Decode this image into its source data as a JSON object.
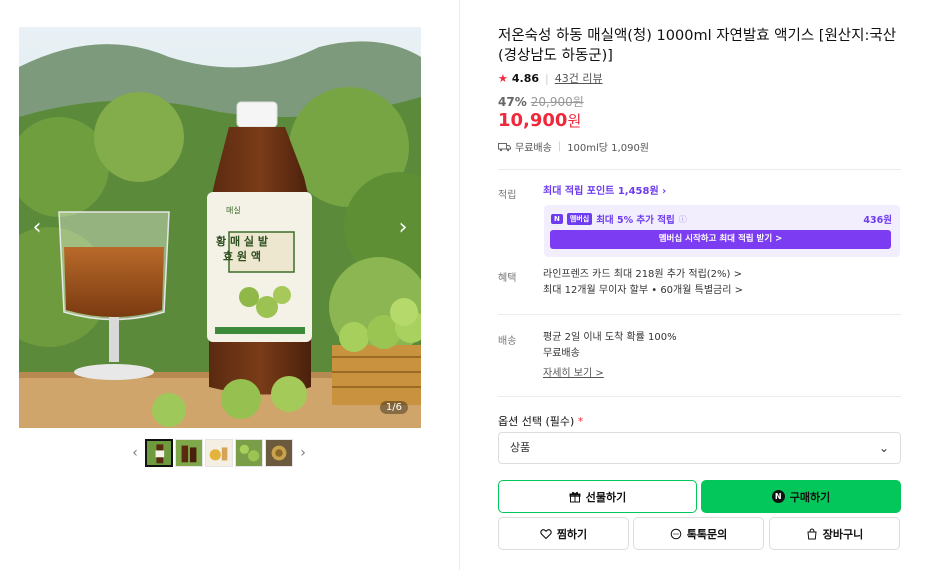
{
  "product": {
    "title": "저온숙성 하동 매실액(청) 1000ml 자연발효 액기스 [원산지:국산(경상남도 하동군)]",
    "rating": "4.86",
    "review_count": "43건 리뷰",
    "discount_rate": "47%",
    "original_price": "20,900원",
    "sale_price": "10,900",
    "sale_price_unit": "원",
    "shipping": "무료배송",
    "unit_price": "100ml당 1,090원"
  },
  "gallery": {
    "counter": "1/6",
    "prev_arrow": "‹",
    "next_arrow": "›",
    "bottle_label_top": "매실",
    "bottle_label_main": "황 매 실 발 효 원 액"
  },
  "points": {
    "label": "적립",
    "max_points": "최대 적립 포인트 1,458원",
    "member_badge_n": "N",
    "member_badge": "멤버십",
    "member_text": "최대 5% 추가 적립",
    "member_points": "436원",
    "member_button": "멤버십 시작하고 최대 적립 받기 >"
  },
  "benefits": {
    "label": "혜택",
    "line1": "라인프렌즈 카드 최대 218원 추가 적립(2%) >",
    "line2": "최대 12개월 무이자 할부 • 60개월 특별금리 >"
  },
  "delivery": {
    "label": "배송",
    "line1": "평균 2일 이내 도착 확률 100%",
    "line2": "무료배송",
    "detail_link": "자세히 보기 >"
  },
  "options": {
    "label": "옵션 선택 (필수)",
    "required_mark": "*",
    "select_value": "상품"
  },
  "buttons": {
    "gift": "선물하기",
    "buy": "구매하기",
    "wish": "찜하기",
    "talk": "톡톡문의",
    "cart": "장바구니"
  },
  "colors": {
    "accent_red": "#f0283c",
    "naver_green": "#03c75a",
    "membership_purple": "#7c3cf2"
  }
}
